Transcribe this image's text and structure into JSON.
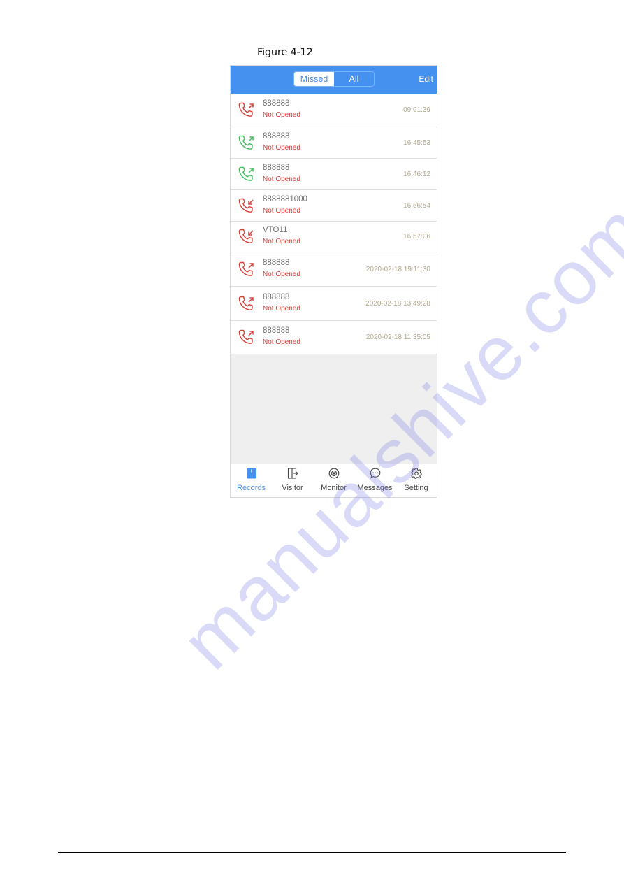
{
  "caption": "Figure 4-12",
  "topbar": {
    "tabs": [
      {
        "label": "Missed",
        "active": true
      },
      {
        "label": "All",
        "active": false
      }
    ],
    "edit_label": "Edit",
    "color": "#4591ef"
  },
  "records": [
    {
      "name": "888888",
      "status": "Not Opened",
      "time": "09:01:39",
      "icon": "outgoing-call-icon",
      "icon_color": "#d6403a"
    },
    {
      "name": "888888",
      "status": "Not Opened",
      "time": "16:45:53",
      "icon": "outgoing-call-icon",
      "icon_color": "#3fbf5a"
    },
    {
      "name": "888888",
      "status": "Not Opened",
      "time": "16:46:12",
      "icon": "outgoing-call-icon",
      "icon_color": "#3fbf5a"
    },
    {
      "name": "8888881000",
      "status": "Not Opened",
      "time": "16:56:54",
      "icon": "incoming-call-icon",
      "icon_color": "#d6403a"
    },
    {
      "name": "VTO11",
      "status": "Not Opened",
      "time": "16:57:06",
      "icon": "incoming-call-icon",
      "icon_color": "#d6403a"
    },
    {
      "name": "888888",
      "status": "Not Opened",
      "time": "2020-02-18 19:11:30",
      "icon": "outgoing-call-icon",
      "icon_color": "#d6403a"
    },
    {
      "name": "888888",
      "status": "Not Opened",
      "time": "2020-02-18 13:49:28",
      "icon": "outgoing-call-icon",
      "icon_color": "#d6403a"
    },
    {
      "name": "888888",
      "status": "Not Opened",
      "time": "2020-02-18 11:35:05",
      "icon": "outgoing-call-icon",
      "icon_color": "#d6403a"
    }
  ],
  "nav": [
    {
      "label": "Records",
      "icon": "records-icon",
      "active": true
    },
    {
      "label": "Visitor",
      "icon": "visitor-door-icon",
      "active": false
    },
    {
      "label": "Monitor",
      "icon": "monitor-camera-icon",
      "active": false
    },
    {
      "label": "Messages",
      "icon": "message-bubble-icon",
      "active": false
    },
    {
      "label": "Setting",
      "icon": "gear-icon",
      "active": false
    }
  ],
  "watermark": "manualshive.com"
}
